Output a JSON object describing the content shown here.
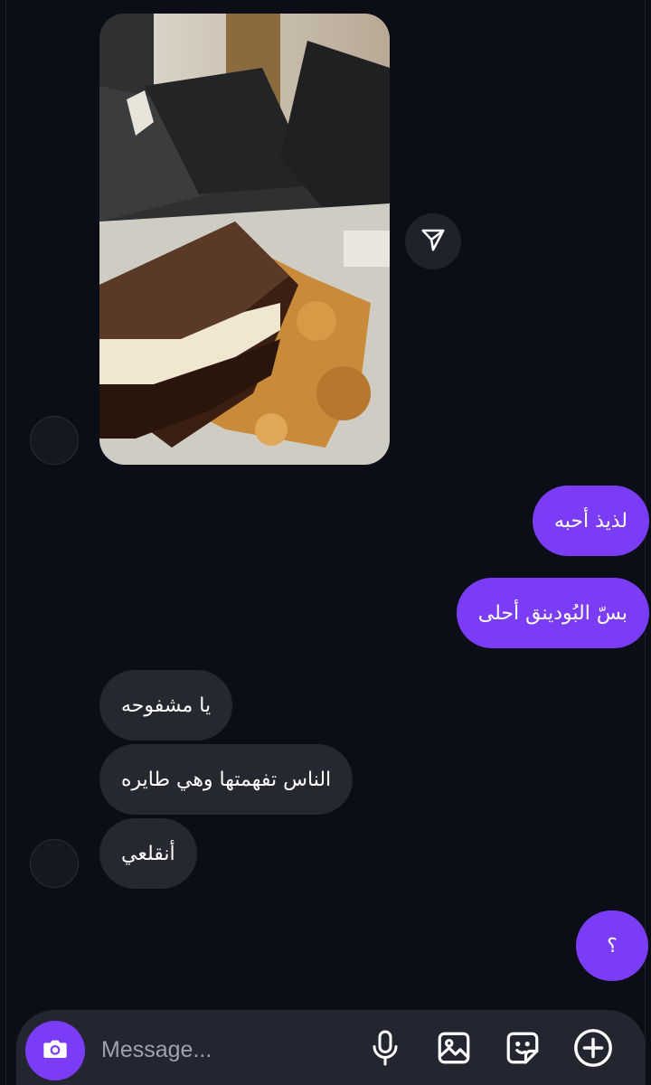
{
  "icons": {
    "share": "send-icon",
    "camera": "camera-icon",
    "mic": "microphone-icon",
    "gallery": "gallery-icon",
    "sticker": "sticker-icon",
    "add": "plus-icon"
  },
  "colors": {
    "background": "#0b0e17",
    "outgoing_bubble": "#7a3cf5",
    "incoming_bubble": "#262830",
    "composer": "#232630"
  },
  "messages": [
    {
      "direction": "outgoing",
      "text": "لذيذ أحبه"
    },
    {
      "direction": "outgoing",
      "text": "بسّ البُودينق أحلى"
    },
    {
      "direction": "incoming",
      "text": "يا مشفوحه"
    },
    {
      "direction": "incoming",
      "text": "الناس تفهمتها وهي طايره"
    },
    {
      "direction": "incoming",
      "text": "أنقلعي"
    },
    {
      "direction": "outgoing",
      "text": "؟"
    }
  ],
  "composer": {
    "placeholder": "Message..."
  }
}
